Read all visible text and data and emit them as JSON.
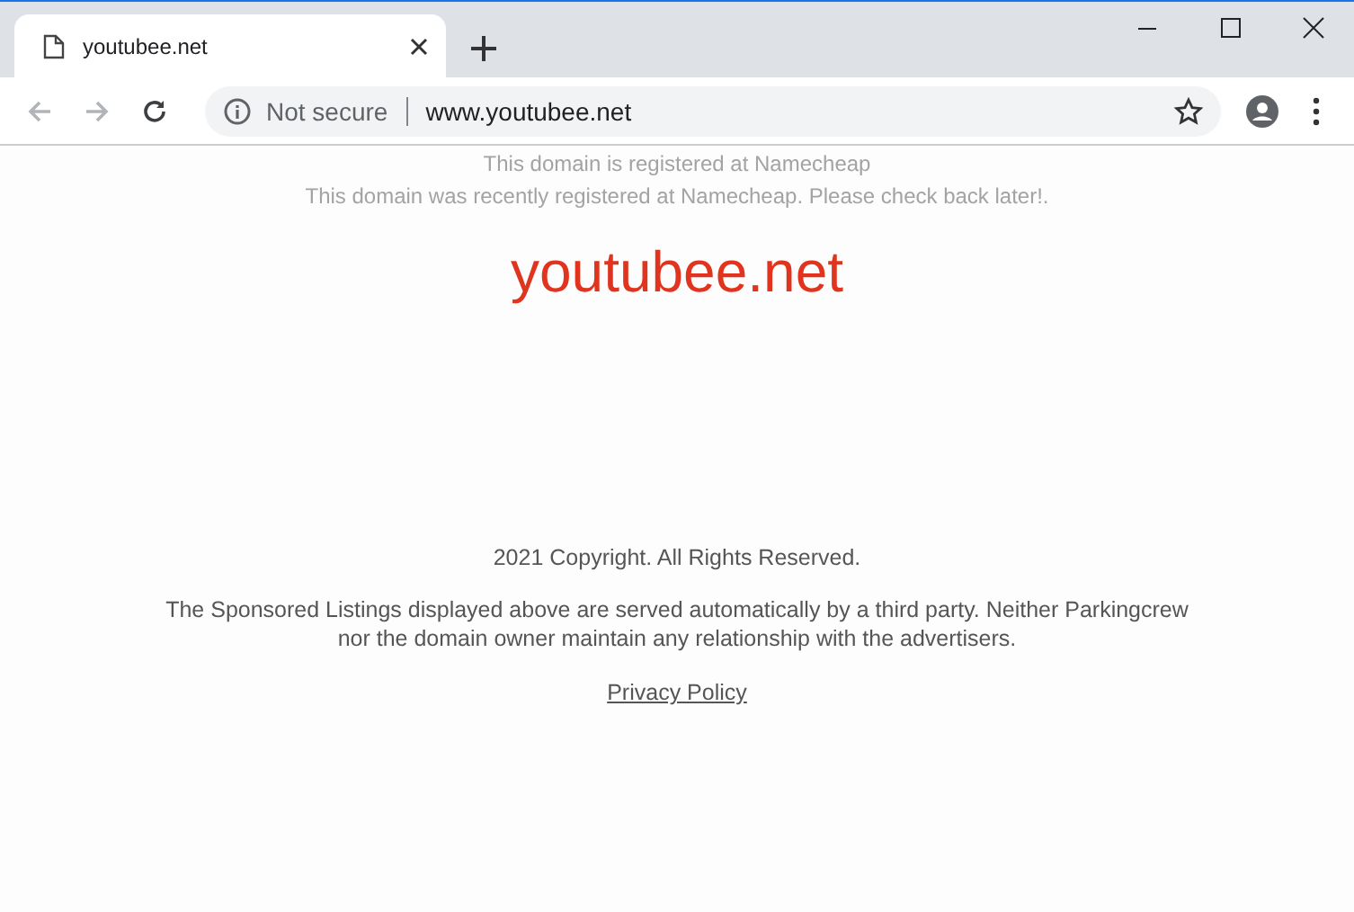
{
  "tab": {
    "title": "youtubee.net"
  },
  "nav_buttons": [
    {
      "kind": "back",
      "disabled": true
    },
    {
      "kind": "forward",
      "disabled": true
    },
    {
      "kind": "reload",
      "disabled": false
    }
  ],
  "address_bar": {
    "security_label": "Not secure",
    "url": "www.youtubee.net"
  },
  "page": {
    "notices": [
      "This domain is registered at Namecheap",
      "This domain was recently registered at Namecheap. Please check back later!."
    ],
    "domain": "youtubee.net",
    "copyright": "2021 Copyright. All Rights Reserved.",
    "disclaimer": "The Sponsored Listings displayed above are served automatically by a third party. Neither Parkingcrew nor the domain owner maintain any relationship with the advertisers.",
    "privacy_link": "Privacy Policy"
  }
}
